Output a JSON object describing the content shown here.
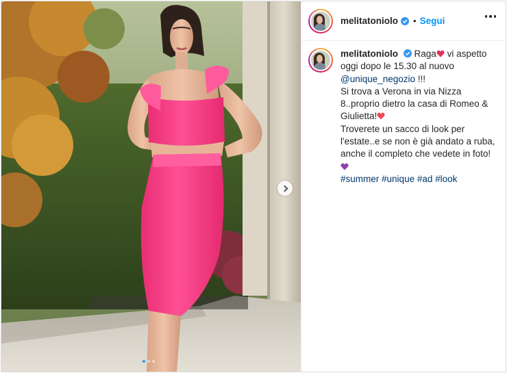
{
  "post": {
    "username": "melitatoniolo",
    "separator": "•",
    "follow_label": "Segui",
    "carousel": {
      "slide_count": 3,
      "active_index": 0
    }
  },
  "caption": {
    "username": "melitatoniolo",
    "part1": "Raga",
    "part2": " vi aspetto oggi dopo le 15.30 al nuovo ",
    "mention": "@unique_negozio",
    "part3": " !!!",
    "line_location": "Si trova a Verona in via Nizza 8..proprio dietro la casa di Romeo & Giulietta!",
    "line_shop": "Troverete un sacco di look per l'estate..e se non è già andato a ruba, anche il completo che vedete in foto!",
    "hashtags": [
      "#summer",
      "#unique",
      "#ad",
      "#look"
    ]
  },
  "colors": {
    "link": "#00376b",
    "follow": "#0095f6",
    "heart_red": "#ed4956",
    "heart_purple": "#8e44ad",
    "outfit": "#ff3d8b"
  },
  "icons": [
    "verified-badge-icon",
    "more-options-icon",
    "next-slide-chevron-icon",
    "heart-icon"
  ]
}
